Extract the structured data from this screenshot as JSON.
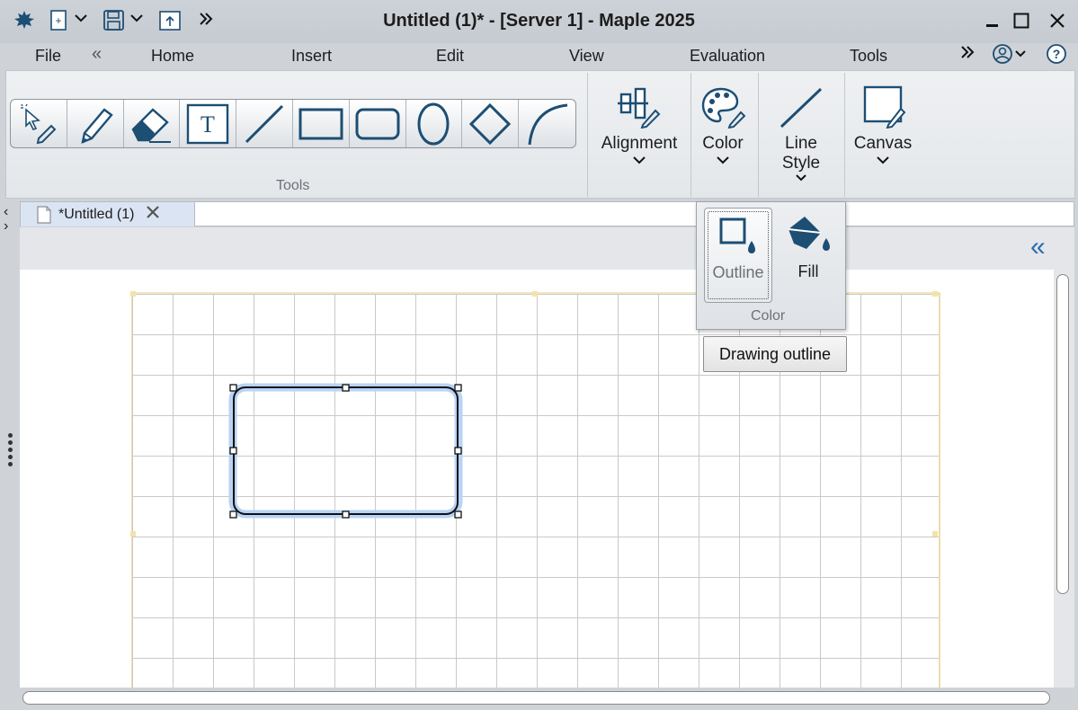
{
  "window": {
    "title": "Untitled (1)* - [Server 1] - Maple 2025",
    "minimize": "‒",
    "maximize": "☐",
    "close": "✕"
  },
  "menu": {
    "file": "File",
    "collapse": "«",
    "tabs": [
      "Home",
      "Insert",
      "Edit",
      "View",
      "Evaluation",
      "Tools"
    ],
    "more": "»"
  },
  "ribbon": {
    "tools_group_label": "Tools",
    "tools": [
      "selector-icon",
      "pencil-icon",
      "eraser-icon",
      "text-icon",
      "line-icon",
      "rectangle-icon",
      "rounded-rectangle-icon",
      "ellipse-icon",
      "diamond-icon",
      "arc-icon"
    ],
    "text_tool_glyph": "T",
    "alignment_label": "Alignment",
    "color_label": "Color",
    "line_style_label_1": "Line",
    "line_style_label_2": "Style",
    "canvas_label": "Canvas",
    "chevron": "⌄"
  },
  "document_tab": {
    "label": "*Untitled (1)",
    "close": "✕"
  },
  "side": {
    "left_arrow": "‹",
    "right_arrow": "›",
    "panel_toggle": "«"
  },
  "color_popup": {
    "outline_label": "Outline",
    "fill_label": "Fill",
    "group_label": "Color",
    "tooltip": "Drawing outline"
  },
  "colors": {
    "accent": "#1d4e73",
    "selection": "#b8d3f5",
    "canvas_grid": "#c9c9c9"
  }
}
